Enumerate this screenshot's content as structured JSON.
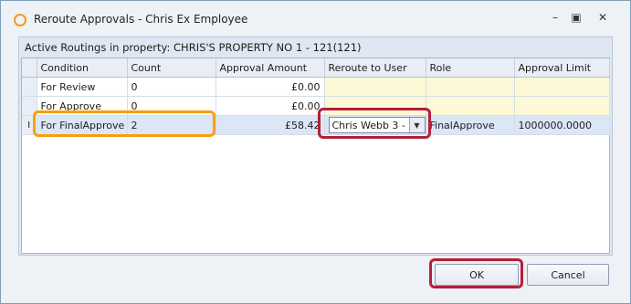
{
  "window": {
    "title": "Reroute Approvals - Chris Ex Employee",
    "icons": {
      "app": "circle-icon",
      "minimize": "minimize-icon",
      "maximize": "maximize-icon",
      "close": "close-icon"
    },
    "controls": {
      "minimize": "–",
      "maximize": "▣",
      "close": "✕"
    }
  },
  "panel": {
    "header": "Active Routings in property: CHRIS'S PROPERTY NO 1 - 121(121)"
  },
  "grid": {
    "columns": [
      "Condition",
      "Count",
      "Approval Amount",
      "Reroute to User",
      "Role",
      "Approval Limit"
    ],
    "rows": [
      {
        "indicator": "",
        "condition": "For Review",
        "count": "0",
        "approval_amount": "£0.00",
        "reroute_to_user": "",
        "role": "",
        "approval_limit": ""
      },
      {
        "indicator": "",
        "condition": "For Approve",
        "count": "0",
        "approval_amount": "£0.00",
        "reroute_to_user": "",
        "role": "",
        "approval_limit": ""
      },
      {
        "indicator": "I",
        "condition": "For FinalApprove",
        "count": "2",
        "approval_amount": "£58.42",
        "reroute_to_user": "Chris Webb 3 - ...",
        "role": "FinalApprove",
        "approval_limit": "1000000.0000"
      }
    ],
    "dropdown_icon": "chevron-down-icon"
  },
  "buttons": {
    "ok": "OK",
    "cancel": "Cancel"
  },
  "colors": {
    "highlight_orange": "#f5a00c",
    "highlight_red": "#b51f3a",
    "yellow_cell": "#fdf8d6",
    "selected_row": "#dbe6f6"
  }
}
